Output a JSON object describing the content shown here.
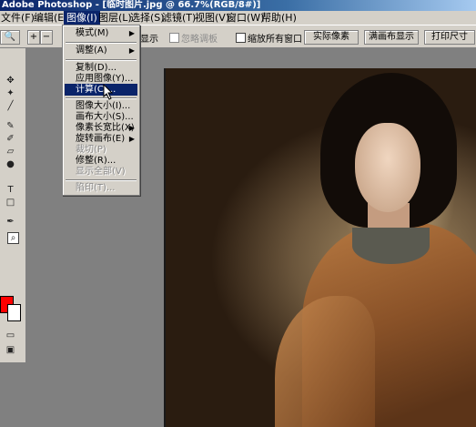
{
  "window": {
    "title": "Adobe Photoshop - [临时图片.jpg @ 66.7%(RGB/8#)]"
  },
  "menubar": {
    "items": [
      {
        "label": "文件(F)"
      },
      {
        "label": "编辑(E)"
      },
      {
        "label": "图像(I)"
      },
      {
        "label": "图层(L)"
      },
      {
        "label": "选择(S)"
      },
      {
        "label": "滤镜(T)"
      },
      {
        "label": "视图(V)"
      },
      {
        "label": "窗口(W)"
      },
      {
        "label": "帮助(H)"
      }
    ],
    "active": "图像(I)"
  },
  "options_bar": {
    "display_suffix": "显示",
    "ignore_palettes_label": "忽略调板",
    "zoom_all_windows_label": "缩放所有窗口",
    "actual_pixels_button": "实际像素",
    "fit_screen_button": "满画布显示",
    "print_size_button": "打印尺寸"
  },
  "image_menu": {
    "items": [
      {
        "label": "模式(M)",
        "submenu": true,
        "enabled": true
      },
      {
        "label": "调整(A)",
        "submenu": true,
        "enabled": true
      },
      {
        "label": "复制(D)...",
        "enabled": true
      },
      {
        "label": "应用图像(Y)...",
        "enabled": true
      },
      {
        "label": "计算(C)...",
        "enabled": true,
        "highlighted": true
      },
      {
        "label": "图像大小(I)...",
        "enabled": true
      },
      {
        "label": "画布大小(S)...",
        "enabled": true
      },
      {
        "label": "像素长宽比(X)",
        "submenu": true,
        "enabled": true
      },
      {
        "label": "旋转画布(E)",
        "submenu": true,
        "enabled": true
      },
      {
        "label": "裁切(P)",
        "enabled": false
      },
      {
        "label": "修整(R)...",
        "enabled": true
      },
      {
        "label": "显示全部(V)",
        "enabled": false
      },
      {
        "label": "陷印(T)...",
        "enabled": false
      }
    ]
  },
  "colors": {
    "foreground": "#ff0000",
    "background": "#ffffff",
    "menu_highlight": "#0a246a"
  }
}
